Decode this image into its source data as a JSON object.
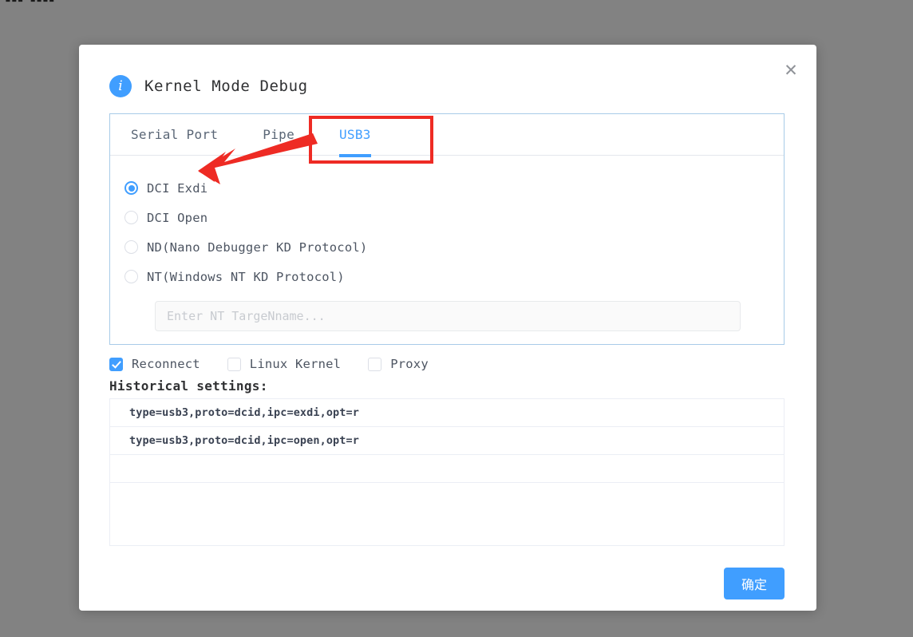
{
  "background": {
    "color": "#828282",
    "top_fragment": "▪▪▪ ▪▪▪▪"
  },
  "dialog": {
    "title": "Kernel Mode Debug",
    "info_icon": "i",
    "close_icon": "✕",
    "tabs": [
      {
        "label": "Serial Port",
        "active": false
      },
      {
        "label": "Pipe",
        "active": false
      },
      {
        "label": "USB3",
        "active": true
      }
    ],
    "radios": [
      {
        "label": "DCI Exdi",
        "selected": true
      },
      {
        "label": "DCI Open",
        "selected": false
      },
      {
        "label": "ND(Nano Debugger KD Protocol)",
        "selected": false
      },
      {
        "label": "NT(Windows NT KD Protocol)",
        "selected": false
      }
    ],
    "nt_input": {
      "value": "",
      "placeholder": "Enter NT TargeNname..."
    },
    "options": [
      {
        "label": "Reconnect",
        "checked": true
      },
      {
        "label": "Linux Kernel",
        "checked": false
      },
      {
        "label": "Proxy",
        "checked": false
      }
    ],
    "history": {
      "title": "Historical settings:",
      "rows": [
        "type=usb3,proto=dcid,ipc=exdi,opt=r",
        "type=usb3,proto=dcid,ipc=open,opt=r",
        "",
        ""
      ]
    },
    "confirm_label": "确定"
  },
  "colors": {
    "accent": "#409eff",
    "annotation": "#ee2b24",
    "panel_border": "#a8cbe8",
    "backdrop": "#828282"
  }
}
